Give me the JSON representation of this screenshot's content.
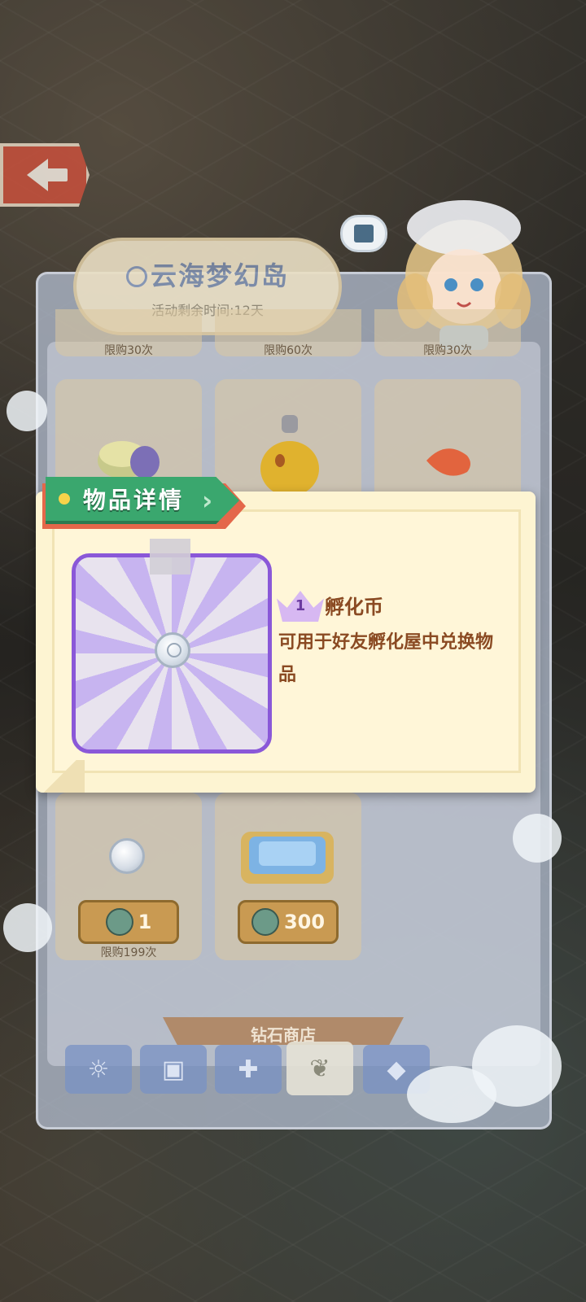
{
  "shop": {
    "title": "云海梦幻岛",
    "remaining": "活动剩余时间:12天",
    "top_row_limits": [
      "限购30次",
      "限购60次",
      "限购30次"
    ],
    "bottom_cards": [
      {
        "price": "1",
        "limit": "限购199次"
      },
      {
        "price": "300",
        "limit": ""
      }
    ],
    "banner_label": "钻石商店",
    "tabs": [
      {
        "icon": "mascot-icon"
      },
      {
        "icon": "ticket-icon"
      },
      {
        "icon": "gift-icon"
      },
      {
        "icon": "leaf-icon",
        "active": true
      },
      {
        "icon": "diamond-icon"
      }
    ]
  },
  "modal": {
    "header_title": "物品详情",
    "item": {
      "rarity": "1",
      "name": "孵化币",
      "description": "可用于好友孵化屋中兑换物品"
    }
  },
  "colors": {
    "header_green": "#3aa76e",
    "header_accent": "#e4674a",
    "item_frame_purple": "#8a58d8",
    "text_brown": "#8a4a22"
  }
}
